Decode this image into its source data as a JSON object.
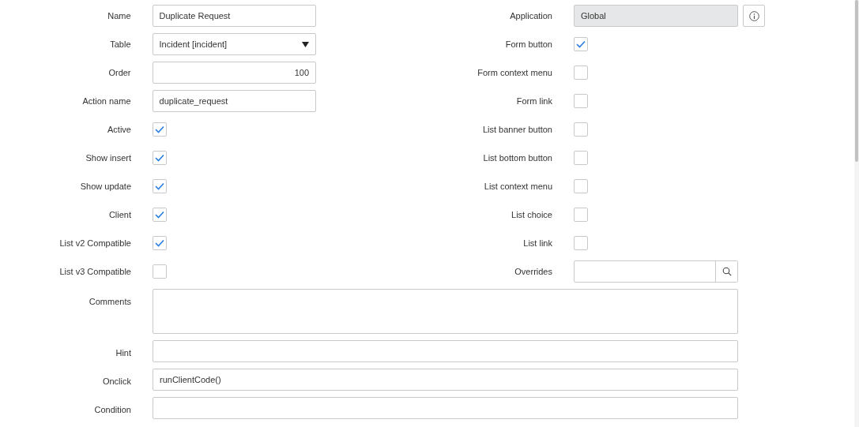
{
  "left_fields": [
    {
      "label": "Name",
      "kind": "text",
      "value": "Duplicate Request"
    },
    {
      "label": "Table",
      "kind": "select",
      "value": "Incident [incident]"
    },
    {
      "label": "Order",
      "kind": "number",
      "value": "100"
    },
    {
      "label": "Action name",
      "kind": "text",
      "value": "duplicate_request"
    },
    {
      "label": "Active",
      "kind": "checkbox",
      "checked": true
    },
    {
      "label": "Show insert",
      "kind": "checkbox",
      "checked": true
    },
    {
      "label": "Show update",
      "kind": "checkbox",
      "checked": true
    },
    {
      "label": "Client",
      "kind": "checkbox",
      "checked": true
    },
    {
      "label": "List v2 Compatible",
      "kind": "checkbox",
      "checked": true
    },
    {
      "label": "List v3 Compatible",
      "kind": "checkbox",
      "checked": false
    }
  ],
  "right_fields": [
    {
      "label": "Application",
      "kind": "readonly",
      "value": "Global"
    },
    {
      "label": "Form button",
      "kind": "checkbox",
      "checked": true
    },
    {
      "label": "Form context menu",
      "kind": "checkbox",
      "checked": false
    },
    {
      "label": "Form link",
      "kind": "checkbox",
      "checked": false
    },
    {
      "label": "List banner button",
      "kind": "checkbox",
      "checked": false
    },
    {
      "label": "List bottom button",
      "kind": "checkbox",
      "checked": false
    },
    {
      "label": "List context menu",
      "kind": "checkbox",
      "checked": false
    },
    {
      "label": "List choice",
      "kind": "checkbox",
      "checked": false
    },
    {
      "label": "List link",
      "kind": "checkbox",
      "checked": false
    },
    {
      "label": "Overrides",
      "kind": "reference"
    }
  ],
  "wide_fields": [
    {
      "label": "Comments",
      "kind": "textarea"
    },
    {
      "label": "Hint",
      "kind": "text"
    },
    {
      "label": "Onclick",
      "kind": "text",
      "value": "runClientCode()"
    },
    {
      "label": "Condition",
      "kind": "text"
    }
  ]
}
